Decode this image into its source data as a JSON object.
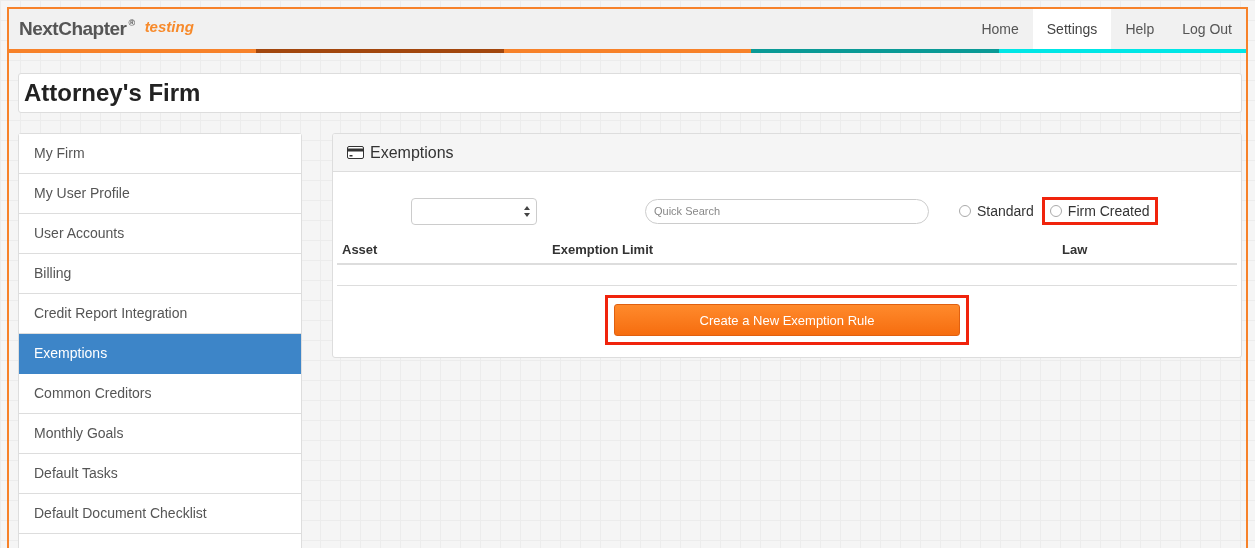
{
  "brand": {
    "logo": "NextChapter",
    "trademark": "®",
    "env": "testing"
  },
  "nav": [
    {
      "label": "Home",
      "selected": false
    },
    {
      "label": "Settings",
      "selected": true
    },
    {
      "label": "Help",
      "selected": false
    },
    {
      "label": "Log Out",
      "selected": false
    }
  ],
  "page_title": "Attorney's Firm",
  "sidebar": {
    "items": [
      {
        "label": "My Firm",
        "selected": false
      },
      {
        "label": "My User Profile",
        "selected": false
      },
      {
        "label": "User Accounts",
        "selected": false
      },
      {
        "label": "Billing",
        "selected": false
      },
      {
        "label": "Credit Report Integration",
        "selected": false
      },
      {
        "label": "Exemptions",
        "selected": true
      },
      {
        "label": "Common Creditors",
        "selected": false
      },
      {
        "label": "Monthly Goals",
        "selected": false
      },
      {
        "label": "Default Tasks",
        "selected": false
      },
      {
        "label": "Default Document Checklist",
        "selected": false
      }
    ]
  },
  "panel": {
    "title": "Exemptions",
    "search": {
      "placeholder": "Quick Search"
    },
    "filters": [
      {
        "label": "Standard",
        "selected": false,
        "highlighted": false
      },
      {
        "label": "Firm Created",
        "selected": false,
        "highlighted": true
      }
    ],
    "table": {
      "columns": [
        "Asset",
        "Exemption Limit",
        "Law"
      ]
    },
    "create_button": {
      "label": "Create a New Exemption Rule",
      "highlighted": true
    }
  }
}
